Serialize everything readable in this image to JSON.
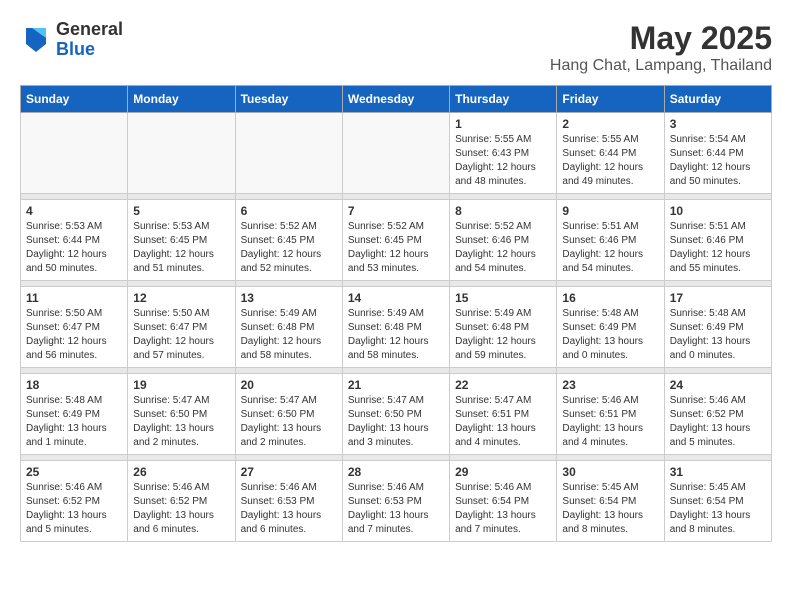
{
  "logo": {
    "general": "General",
    "blue": "Blue"
  },
  "title": "May 2025",
  "subtitle": "Hang Chat, Lampang, Thailand",
  "days_header": [
    "Sunday",
    "Monday",
    "Tuesday",
    "Wednesday",
    "Thursday",
    "Friday",
    "Saturday"
  ],
  "weeks": [
    [
      {
        "num": "",
        "detail": ""
      },
      {
        "num": "",
        "detail": ""
      },
      {
        "num": "",
        "detail": ""
      },
      {
        "num": "",
        "detail": ""
      },
      {
        "num": "1",
        "detail": "Sunrise: 5:55 AM\nSunset: 6:43 PM\nDaylight: 12 hours\nand 48 minutes."
      },
      {
        "num": "2",
        "detail": "Sunrise: 5:55 AM\nSunset: 6:44 PM\nDaylight: 12 hours\nand 49 minutes."
      },
      {
        "num": "3",
        "detail": "Sunrise: 5:54 AM\nSunset: 6:44 PM\nDaylight: 12 hours\nand 50 minutes."
      }
    ],
    [
      {
        "num": "4",
        "detail": "Sunrise: 5:53 AM\nSunset: 6:44 PM\nDaylight: 12 hours\nand 50 minutes."
      },
      {
        "num": "5",
        "detail": "Sunrise: 5:53 AM\nSunset: 6:45 PM\nDaylight: 12 hours\nand 51 minutes."
      },
      {
        "num": "6",
        "detail": "Sunrise: 5:52 AM\nSunset: 6:45 PM\nDaylight: 12 hours\nand 52 minutes."
      },
      {
        "num": "7",
        "detail": "Sunrise: 5:52 AM\nSunset: 6:45 PM\nDaylight: 12 hours\nand 53 minutes."
      },
      {
        "num": "8",
        "detail": "Sunrise: 5:52 AM\nSunset: 6:46 PM\nDaylight: 12 hours\nand 54 minutes."
      },
      {
        "num": "9",
        "detail": "Sunrise: 5:51 AM\nSunset: 6:46 PM\nDaylight: 12 hours\nand 54 minutes."
      },
      {
        "num": "10",
        "detail": "Sunrise: 5:51 AM\nSunset: 6:46 PM\nDaylight: 12 hours\nand 55 minutes."
      }
    ],
    [
      {
        "num": "11",
        "detail": "Sunrise: 5:50 AM\nSunset: 6:47 PM\nDaylight: 12 hours\nand 56 minutes."
      },
      {
        "num": "12",
        "detail": "Sunrise: 5:50 AM\nSunset: 6:47 PM\nDaylight: 12 hours\nand 57 minutes."
      },
      {
        "num": "13",
        "detail": "Sunrise: 5:49 AM\nSunset: 6:48 PM\nDaylight: 12 hours\nand 58 minutes."
      },
      {
        "num": "14",
        "detail": "Sunrise: 5:49 AM\nSunset: 6:48 PM\nDaylight: 12 hours\nand 58 minutes."
      },
      {
        "num": "15",
        "detail": "Sunrise: 5:49 AM\nSunset: 6:48 PM\nDaylight: 12 hours\nand 59 minutes."
      },
      {
        "num": "16",
        "detail": "Sunrise: 5:48 AM\nSunset: 6:49 PM\nDaylight: 13 hours\nand 0 minutes."
      },
      {
        "num": "17",
        "detail": "Sunrise: 5:48 AM\nSunset: 6:49 PM\nDaylight: 13 hours\nand 0 minutes."
      }
    ],
    [
      {
        "num": "18",
        "detail": "Sunrise: 5:48 AM\nSunset: 6:49 PM\nDaylight: 13 hours\nand 1 minute."
      },
      {
        "num": "19",
        "detail": "Sunrise: 5:47 AM\nSunset: 6:50 PM\nDaylight: 13 hours\nand 2 minutes."
      },
      {
        "num": "20",
        "detail": "Sunrise: 5:47 AM\nSunset: 6:50 PM\nDaylight: 13 hours\nand 2 minutes."
      },
      {
        "num": "21",
        "detail": "Sunrise: 5:47 AM\nSunset: 6:50 PM\nDaylight: 13 hours\nand 3 minutes."
      },
      {
        "num": "22",
        "detail": "Sunrise: 5:47 AM\nSunset: 6:51 PM\nDaylight: 13 hours\nand 4 minutes."
      },
      {
        "num": "23",
        "detail": "Sunrise: 5:46 AM\nSunset: 6:51 PM\nDaylight: 13 hours\nand 4 minutes."
      },
      {
        "num": "24",
        "detail": "Sunrise: 5:46 AM\nSunset: 6:52 PM\nDaylight: 13 hours\nand 5 minutes."
      }
    ],
    [
      {
        "num": "25",
        "detail": "Sunrise: 5:46 AM\nSunset: 6:52 PM\nDaylight: 13 hours\nand 5 minutes."
      },
      {
        "num": "26",
        "detail": "Sunrise: 5:46 AM\nSunset: 6:52 PM\nDaylight: 13 hours\nand 6 minutes."
      },
      {
        "num": "27",
        "detail": "Sunrise: 5:46 AM\nSunset: 6:53 PM\nDaylight: 13 hours\nand 6 minutes."
      },
      {
        "num": "28",
        "detail": "Sunrise: 5:46 AM\nSunset: 6:53 PM\nDaylight: 13 hours\nand 7 minutes."
      },
      {
        "num": "29",
        "detail": "Sunrise: 5:46 AM\nSunset: 6:54 PM\nDaylight: 13 hours\nand 7 minutes."
      },
      {
        "num": "30",
        "detail": "Sunrise: 5:45 AM\nSunset: 6:54 PM\nDaylight: 13 hours\nand 8 minutes."
      },
      {
        "num": "31",
        "detail": "Sunrise: 5:45 AM\nSunset: 6:54 PM\nDaylight: 13 hours\nand 8 minutes."
      }
    ]
  ]
}
